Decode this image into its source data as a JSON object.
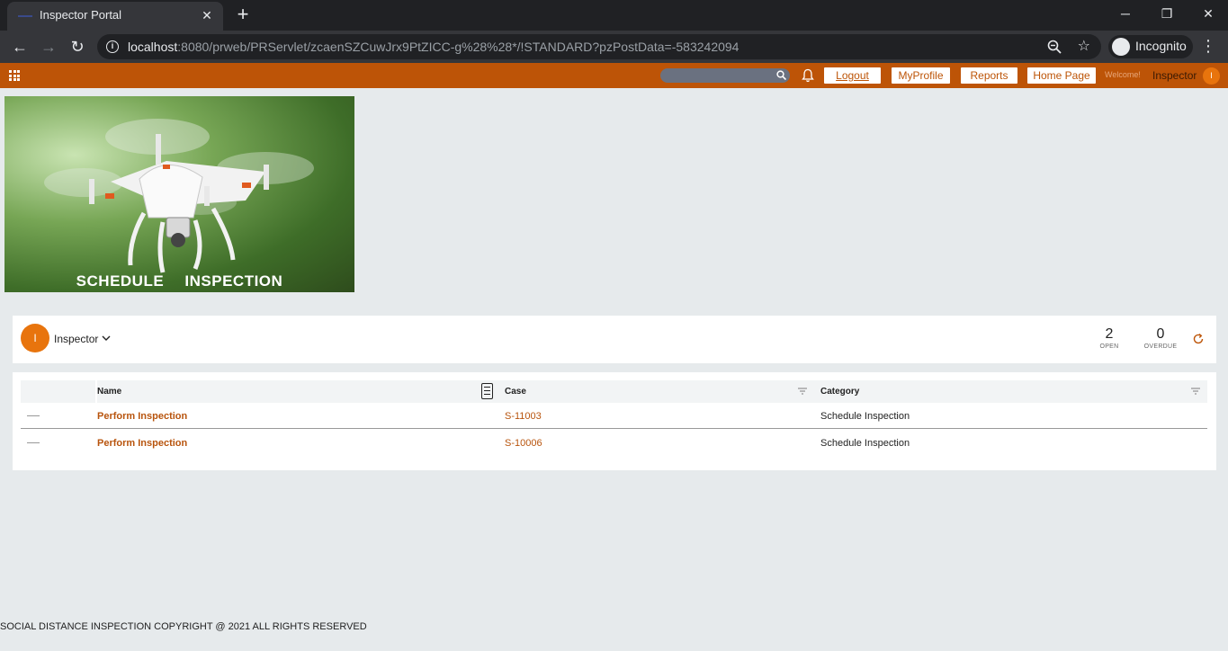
{
  "browser": {
    "tab_title": "Inspector Portal",
    "url_host": "localhost",
    "url_rest": ":8080/prweb/PRServlet/zcaenSZCuwJrx9PtZICC-g%28%28*/!STANDARD?pzPostData=-583242094",
    "incognito_label": "Incognito"
  },
  "header": {
    "buttons": [
      "Logout",
      "MyProfile",
      "Reports",
      "Home Page"
    ],
    "welcome": "Welcome!",
    "user_name": "Inspector",
    "user_initial": "I",
    "colors": {
      "bar": "#bd5407",
      "accent": "#e8740d"
    }
  },
  "banner": {
    "caption": "SCHEDULE INSPECTION"
  },
  "worklist": {
    "initial": "I",
    "owner": "Inspector",
    "open_count": "2",
    "open_label": "OPEN",
    "overdue_count": "0",
    "overdue_label": "OVERDUE"
  },
  "table": {
    "columns": [
      "Name",
      "Case",
      "Category"
    ],
    "rows": [
      {
        "name": "Perform Inspection",
        "case": "S-11003",
        "category": "Schedule Inspection"
      },
      {
        "name": "Perform Inspection",
        "case": "S-10006",
        "category": "Schedule Inspection"
      }
    ]
  },
  "footer": {
    "text": "SOCIAL DISTANCE INSPECTION COPYRIGHT @ 2021 ALL RIGHTS RESERVED"
  }
}
